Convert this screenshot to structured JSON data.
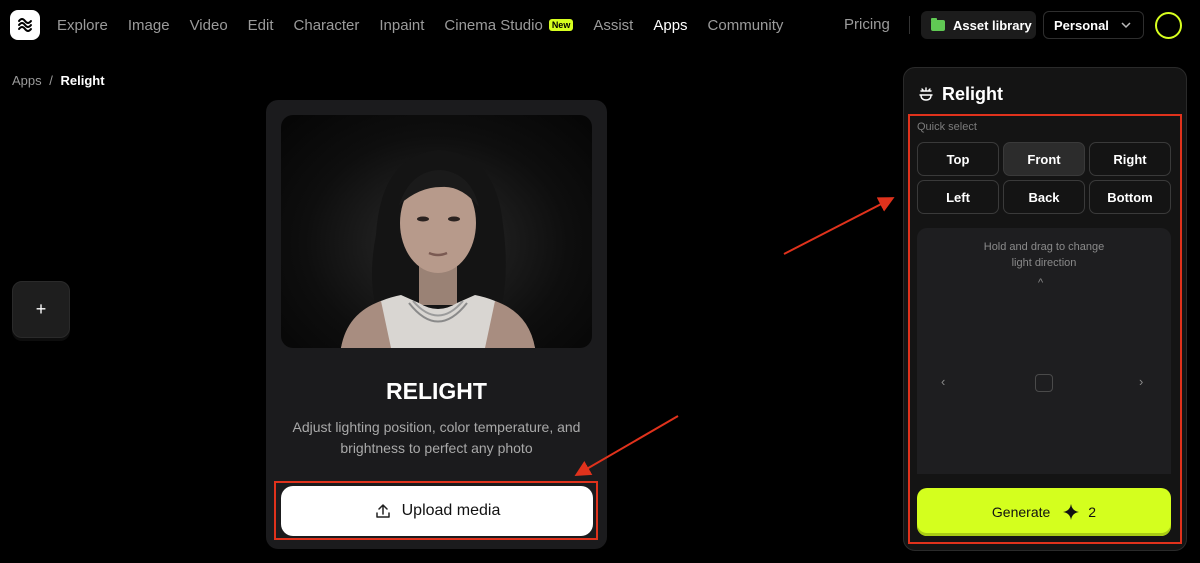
{
  "nav": {
    "items": [
      {
        "label": "Explore"
      },
      {
        "label": "Image"
      },
      {
        "label": "Video"
      },
      {
        "label": "Edit"
      },
      {
        "label": "Character"
      },
      {
        "label": "Inpaint"
      },
      {
        "label": "Cinema Studio",
        "badge": "New"
      },
      {
        "label": "Assist"
      },
      {
        "label": "Apps",
        "active": true
      },
      {
        "label": "Community"
      }
    ],
    "pricing": "Pricing",
    "asset_library": "Asset library",
    "workspace": "Personal"
  },
  "breadcrumb": {
    "parent": "Apps",
    "separator": "/",
    "current": "Relight"
  },
  "add_button": "+",
  "card": {
    "title": "RELIGHT",
    "description": "Adjust lighting position, color temperature, and brightness to perfect any photo",
    "upload_label": "Upload media"
  },
  "panel": {
    "title": "Relight",
    "quick_select_label": "Quick select",
    "quick_select": [
      "Top",
      "Front",
      "Right",
      "Left",
      "Back",
      "Bottom"
    ],
    "selected": "Front",
    "direction_hint": "Hold and drag to change light direction",
    "up_glyph": "^",
    "left_glyph": "‹",
    "right_glyph": "›",
    "generate_label": "Generate",
    "generate_cost": "2"
  },
  "colors": {
    "accent": "#d4ff1e",
    "annotation": "#e0321c",
    "folder": "#60c954"
  }
}
